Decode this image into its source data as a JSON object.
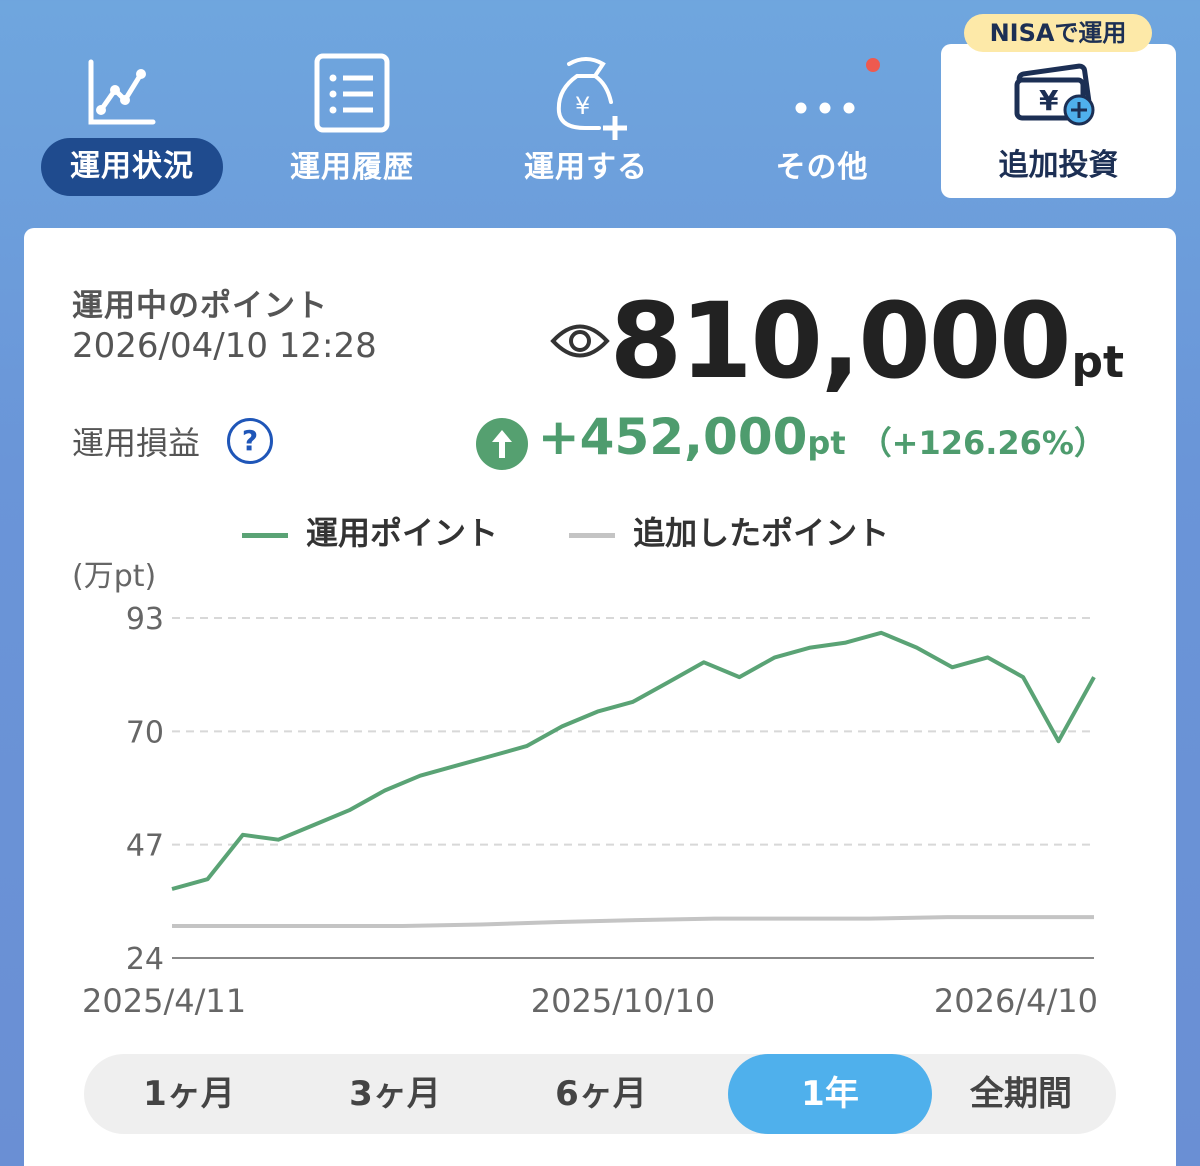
{
  "nav": {
    "items": [
      {
        "label": "運用状況",
        "icon": "line-chart-icon",
        "active": true
      },
      {
        "label": "運用履歴",
        "icon": "list-icon",
        "active": false
      },
      {
        "label": "運用する",
        "icon": "money-bag-plus-icon",
        "active": false
      },
      {
        "label": "その他",
        "icon": "more-dots-icon",
        "active": false
      }
    ],
    "nisa": {
      "tag": "NISAで運用",
      "label": "追加投資",
      "icon": "wallet-yen-plus-icon"
    }
  },
  "summary": {
    "title": "運用中のポイント",
    "timestamp": "2026/04/10 12:28",
    "points": "810,000",
    "points_unit": "pt",
    "pl_label": "運用損益",
    "help": "?",
    "gain": "+452,000",
    "gain_unit": "pt",
    "gain_pct": "（+126.26%）"
  },
  "legend": {
    "managed": "運用ポイント",
    "added": "追加したポイント"
  },
  "colors": {
    "managed": "#5aa375",
    "added": "#c4c4c4",
    "active_tab": "#4fb0ec"
  },
  "chart_data": {
    "type": "line",
    "ylabel": "(万pt)",
    "ylim": [
      24,
      93
    ],
    "yticks": [
      "93",
      "70",
      "47",
      "24"
    ],
    "xticks": [
      "2025/4/11",
      "2025/10/10",
      "2026/4/10"
    ],
    "series": [
      {
        "name": "運用ポイント",
        "x": [
          "2025/4/11",
          "2025/4/25",
          "2025/5/9",
          "2025/5/23",
          "2025/6/6",
          "2025/6/20",
          "2025/7/4",
          "2025/7/18",
          "2025/8/1",
          "2025/8/15",
          "2025/8/29",
          "2025/9/12",
          "2025/9/26",
          "2025/10/10",
          "2025/10/24",
          "2025/11/7",
          "2025/11/21",
          "2025/12/5",
          "2025/12/19",
          "2026/1/2",
          "2026/1/16",
          "2026/1/30",
          "2026/2/13",
          "2026/2/27",
          "2026/3/13",
          "2026/3/27",
          "2026/4/10"
        ],
        "values": [
          38,
          40,
          49,
          48,
          51,
          54,
          58,
          61,
          63,
          65,
          67,
          71,
          74,
          76,
          80,
          84,
          81,
          85,
          87,
          88,
          90,
          87,
          83,
          85,
          81,
          68,
          81
        ]
      },
      {
        "name": "追加したポイント",
        "x": [
          "2025/4/11",
          "2025/5/11",
          "2025/6/11",
          "2025/7/11",
          "2025/8/11",
          "2025/9/11",
          "2025/10/11",
          "2025/11/11",
          "2025/12/11",
          "2026/1/11",
          "2026/2/11",
          "2026/3/11",
          "2026/4/10"
        ],
        "values": [
          30.5,
          30.5,
          30.5,
          30.5,
          30.8,
          31.3,
          31.7,
          32.0,
          32.0,
          32.0,
          32.3,
          32.3,
          32.3
        ]
      }
    ]
  },
  "periods": {
    "items": [
      "1ヶ月",
      "3ヶ月",
      "6ヶ月",
      "1年",
      "全期間"
    ],
    "active": 3
  }
}
